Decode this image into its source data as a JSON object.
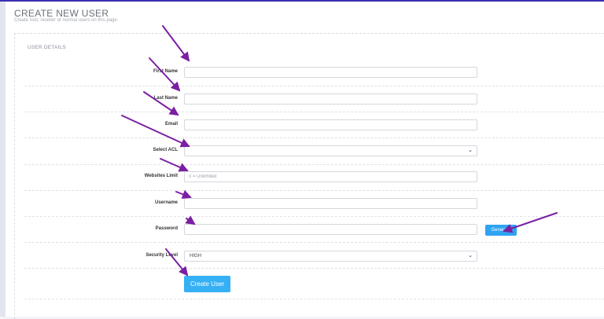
{
  "page": {
    "title": "CREATE NEW USER",
    "subtitle": "Create root, reseller or normal users on this page."
  },
  "section": {
    "label": "USER DETAILS"
  },
  "form": {
    "first_name": {
      "label": "First Name",
      "value": ""
    },
    "last_name": {
      "label": "Last Name",
      "value": ""
    },
    "email": {
      "label": "Email",
      "value": ""
    },
    "acl": {
      "label": "Select ACL",
      "selected": ""
    },
    "websites_limit": {
      "label": "Websites Limit",
      "placeholder": "0 = Unlimited",
      "value": ""
    },
    "username": {
      "label": "Username",
      "value": ""
    },
    "password": {
      "label": "Password",
      "value": ""
    },
    "generate_label": "Generate",
    "security_level": {
      "label": "Security Level",
      "selected": "HIGH"
    },
    "submit_label": "Create User"
  },
  "colors": {
    "primary_button": "#35b0f4",
    "annotation_arrow": "#7a1fa2",
    "top_accent": "#3a2fb0"
  }
}
